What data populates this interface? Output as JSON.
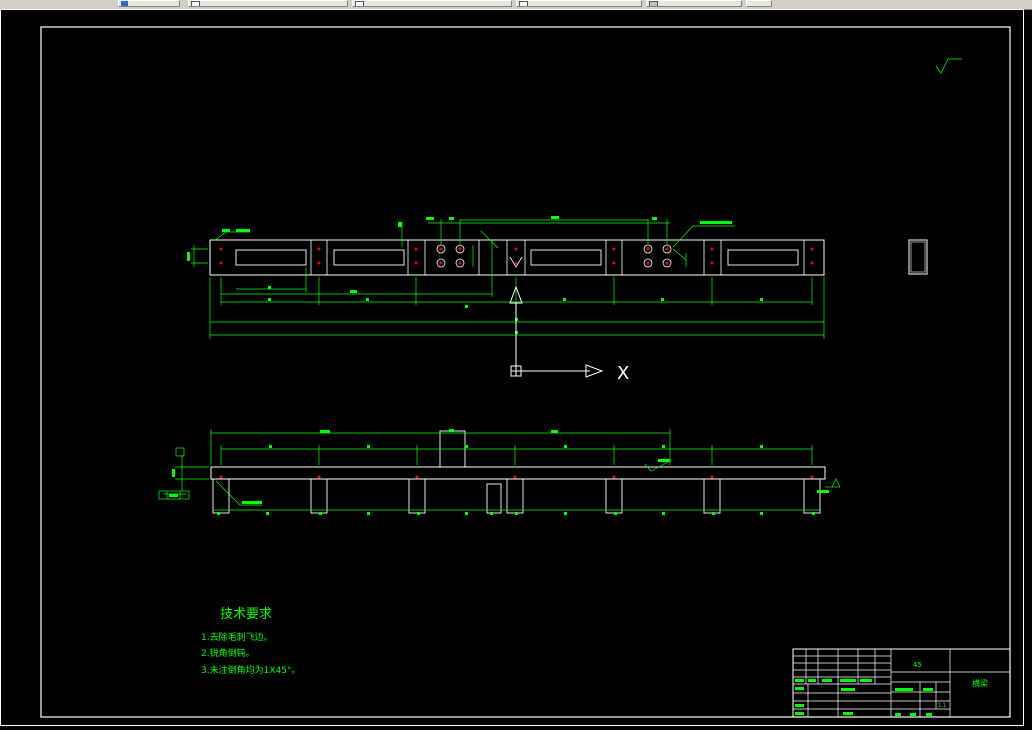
{
  "taskbar": {
    "items": [
      {
        "label": ""
      },
      {
        "label": ""
      },
      {
        "label": ""
      },
      {
        "label": ""
      },
      {
        "label": ""
      },
      {
        "label": ""
      }
    ]
  },
  "drawing": {
    "axis_label": "X",
    "roughness_note": "",
    "technical_requirements": {
      "title": "技术要求",
      "items": [
        "1.去除毛刺飞边。",
        "2.锐角倒钝。",
        "3.未注倒角均为1X45°。"
      ]
    },
    "title_block": {
      "material": "45",
      "part_name": "横梁",
      "scale": "1:1"
    }
  },
  "colors": {
    "background": "#000000",
    "geometry": "#ffffff",
    "dimension": "#00ff00",
    "center_mark": "#ff0000"
  },
  "icons": [
    "blue-arrow-icon",
    "cube-icon",
    "document-icon",
    "window-icon"
  ]
}
